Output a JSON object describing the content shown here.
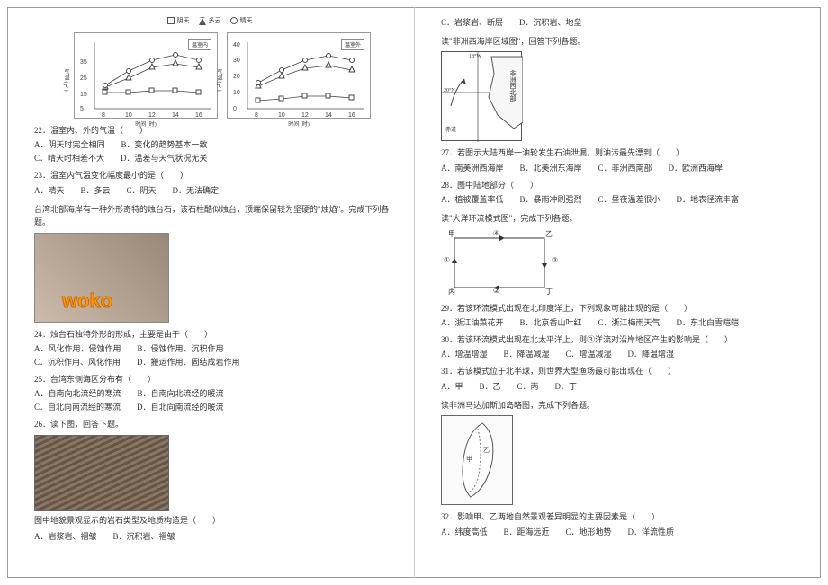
{
  "chart_data": [
    {
      "type": "line",
      "title": "温室内",
      "xlabel": "时间 (时)",
      "ylabel": "气温 (℃)",
      "x": [
        8,
        10,
        12,
        14,
        16
      ],
      "ylim": [
        5,
        40
      ],
      "legend_top": [
        "阴天",
        "多云",
        "晴天"
      ],
      "series": [
        {
          "name": "阴天",
          "symbol": "square",
          "values": [
            14,
            14,
            15,
            15,
            14
          ]
        },
        {
          "name": "多云",
          "symbol": "triangle",
          "values": [
            17,
            22,
            28,
            30,
            28
          ]
        },
        {
          "name": "晴天",
          "symbol": "circle",
          "values": [
            18,
            26,
            32,
            35,
            32
          ]
        }
      ]
    },
    {
      "type": "line",
      "title": "温室外",
      "xlabel": "时间 (时)",
      "ylabel": "气温 (℃)",
      "x": [
        8,
        10,
        12,
        14,
        16
      ],
      "ylim": [
        0,
        40
      ],
      "legend_top": [
        "阴天",
        "多云",
        "晴天"
      ],
      "series": [
        {
          "name": "阴天",
          "symbol": "square",
          "values": [
            5,
            6,
            8,
            8,
            7
          ]
        },
        {
          "name": "多云",
          "symbol": "triangle",
          "values": [
            14,
            20,
            25,
            27,
            24
          ]
        },
        {
          "name": "晴天",
          "symbol": "circle",
          "values": [
            16,
            24,
            30,
            33,
            30
          ]
        }
      ]
    }
  ],
  "legend": {
    "a": "阴天",
    "b": "多云",
    "c": "晴天"
  },
  "chart": {
    "ylabel": "气温 (℃)",
    "xlabel": "时间 (时)",
    "inside": "温室内",
    "outside": "温室外"
  },
  "q22": {
    "text": "22．温室内、外的气温（　　）",
    "a": "A．阴天时完全相同",
    "b": "B．变化的趋势基本一致",
    "c": "C．晴天时相差不大",
    "d": "D．温差与天气状况无关"
  },
  "q23": {
    "text": "23．温室内气温变化幅度最小的是（　　）",
    "a": "A．晴天",
    "b": "B．多云",
    "c": "C．阴天",
    "d": "D．无法确定"
  },
  "stem_tw": "台湾北部海岸有一种外形奇特的烛台石，该石柱酷似烛台，顶端保留较为坚硬的\"烛焰\"。完成下列各题。",
  "candle_img": {
    "overlay": "woko"
  },
  "q24": {
    "text": "24．烛台石独特外形的形成，主要是由于（　　）",
    "a": "A．风化作用、侵蚀作用",
    "b": "B．侵蚀作用、沉积作用",
    "c": "C．沉积作用、风化作用",
    "d": "D．搬运作用、固结成岩作用"
  },
  "q25": {
    "text": "25．台湾东侧海区分布有（　　）",
    "a": "A．自南向北流经的寒流",
    "b": "B．自南向北流经的暖流",
    "c": "C．自北向南流经的寒流",
    "d": "D．自北向南流经的暖流"
  },
  "q26": {
    "text": "26．读下图，回答下题。",
    "stem": "图中地貌景观显示的岩石类型及地质构造是（　　）",
    "a": "A．岩浆岩、褶皱",
    "b": "B．沉积岩、褶皱"
  },
  "q26r": {
    "c": "C．岩浆岩、断层",
    "d": "D．沉积岩、地垒"
  },
  "stem_af": "读\"非洲西海岸区域图\"，回答下列各题。",
  "map_af": {
    "lon": "18°W",
    "lat": "20°N",
    "label": "非洲西北部",
    "eq": "赤道"
  },
  "q27": {
    "text": "27．若图示大陆西岸一油轮发生石油泄漏，则油污最先漂到（　　）",
    "a": "A．南美洲西海岸",
    "b": "B．北美洲东海岸",
    "c": "C．非洲西南部",
    "d": "D．欧洲西海岸"
  },
  "q28": {
    "text": "28．图中陆地部分（　　）",
    "a": "A．植被覆盖率低",
    "b": "B．暴雨冲刷强烈",
    "c": "C．昼夜温差很小",
    "d": "D．地表径流丰富"
  },
  "stem_oc": "读\"大洋环流模式图\"，完成下列各题。",
  "ocean": {
    "jia": "甲",
    "yi": "乙",
    "bing": "丙",
    "ding": "丁",
    "n1": "①",
    "n2": "②",
    "n3": "③",
    "n4": "④"
  },
  "q29": {
    "text": "29．若该环流模式出现在北印度洋上，下列现象可能出现的是（　　）",
    "a": "A．浙江油菜花开",
    "b": "B．北京香山叶红",
    "c": "C．浙江梅雨天气",
    "d": "D．东北白雪皑皑"
  },
  "q30": {
    "text": "30．若该环流模式出现在北太平洋上，则③洋流对沿岸地区产生的影响是（　　）",
    "a": "A．增温增湿",
    "b": "B．降温减湿",
    "c": "C．增温减湿",
    "d": "D．降温增湿"
  },
  "q31": {
    "text": "31．若该模式位于北半球，则世界大型渔场最可能出现在（　　）",
    "a": "A．甲",
    "b": "B．乙",
    "c": "C．丙",
    "d": "D．丁"
  },
  "stem_mg": "读非洲马达加斯加岛略图，完成下列各题。",
  "q32": {
    "text": "32．影响甲、乙两地自然景观差异明显的主要因素是（　　）",
    "a": "A．纬度高低",
    "b": "B．距海远近",
    "c": "C．地形地势",
    "d": "D．洋流性质"
  }
}
